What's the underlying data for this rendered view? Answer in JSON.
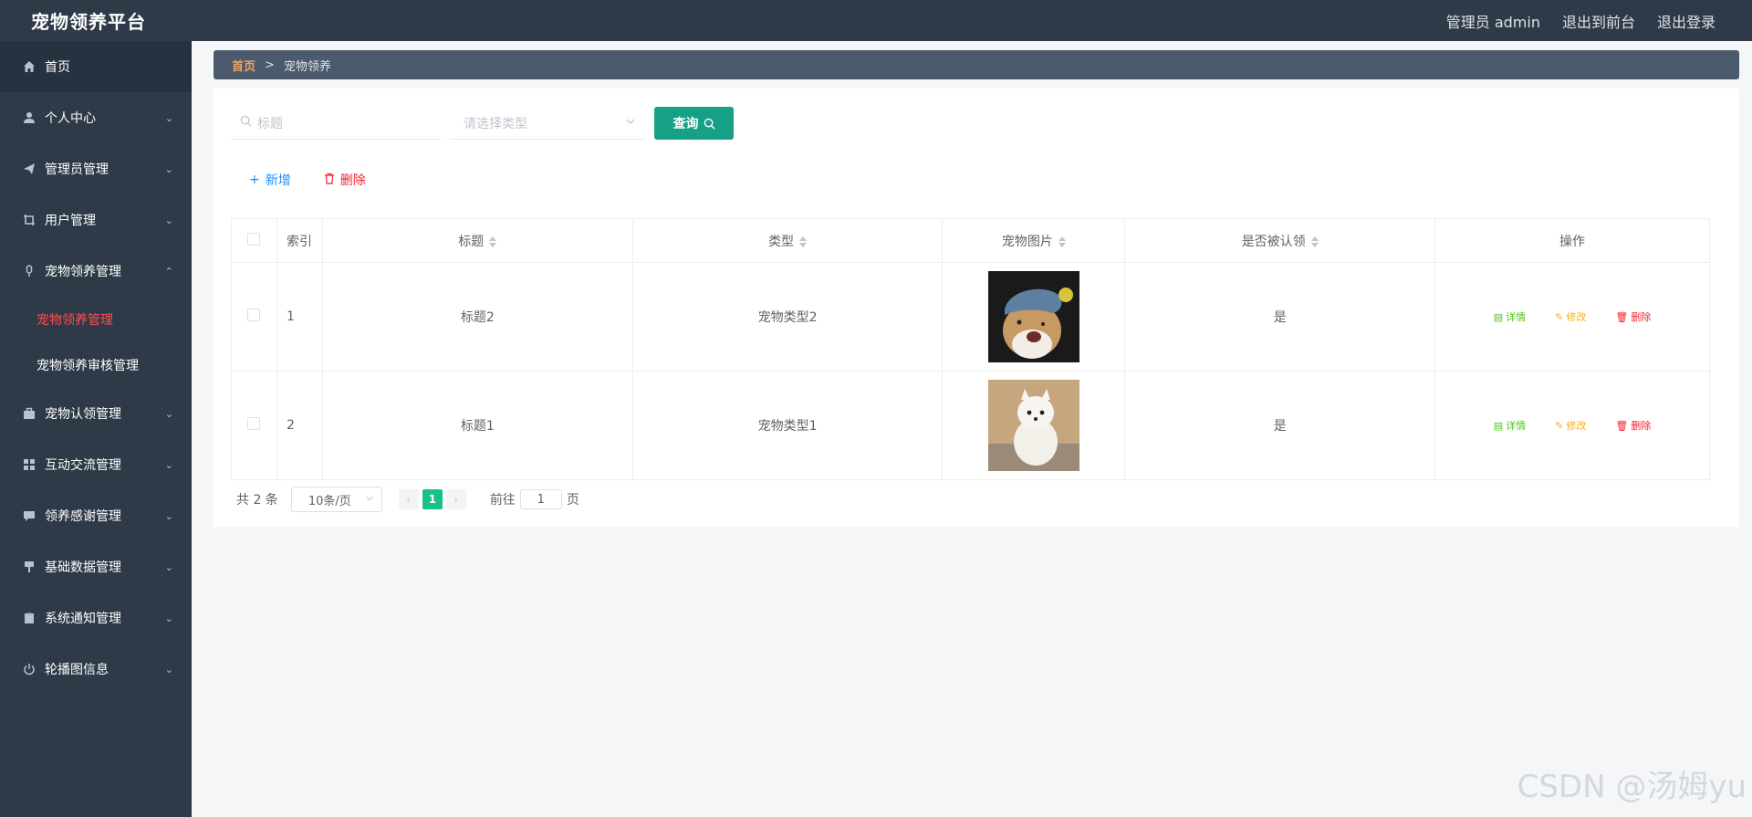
{
  "header": {
    "brand": "宠物领养平台",
    "admin_label": "管理员 admin",
    "front_link": "退出到前台",
    "logout_link": "退出登录"
  },
  "sidebar": {
    "items": [
      {
        "label": "首页",
        "icon": "home-icon"
      },
      {
        "label": "个人中心",
        "icon": "user-icon"
      },
      {
        "label": "管理员管理",
        "icon": "send-icon"
      },
      {
        "label": "用户管理",
        "icon": "crop-icon"
      },
      {
        "label": "宠物领养管理",
        "icon": "mic-icon",
        "expanded": true,
        "children": [
          {
            "label": "宠物领养管理",
            "active": true
          },
          {
            "label": "宠物领养审核管理",
            "active": false
          }
        ]
      },
      {
        "label": "宠物认领管理",
        "icon": "briefcase-icon"
      },
      {
        "label": "互动交流管理",
        "icon": "grid-icon"
      },
      {
        "label": "领养感谢管理",
        "icon": "comment-icon"
      },
      {
        "label": "基础数据管理",
        "icon": "pin-icon"
      },
      {
        "label": "系统通知管理",
        "icon": "clipboard-icon"
      },
      {
        "label": "轮播图信息",
        "icon": "power-icon"
      }
    ]
  },
  "breadcrumb": {
    "home": "首页",
    "separator": ">",
    "current": "宠物领养"
  },
  "search": {
    "title_placeholder": "标题",
    "type_placeholder": "请选择类型",
    "query_button": "查询"
  },
  "actions": {
    "add": "新增",
    "delete": "删除"
  },
  "table": {
    "columns": [
      "索引",
      "标题",
      "类型",
      "宠物图片",
      "是否被认领",
      "操作"
    ],
    "rows": [
      {
        "index": "1",
        "title": "标题2",
        "type": "宠物类型2",
        "image": "dog-with-hat",
        "claimed": "是"
      },
      {
        "index": "2",
        "title": "标题1",
        "type": "宠物类型1",
        "image": "white-pomeranian",
        "claimed": "是"
      }
    ],
    "row_actions": {
      "detail": "详情",
      "edit": "修改",
      "delete": "删除"
    }
  },
  "pagination": {
    "total_text": "共 2 条",
    "page_size": "10条/页",
    "current_page": "1",
    "jump_prefix": "前往",
    "jump_value": "1",
    "jump_suffix": "页"
  },
  "watermark": "CSDN @汤姆yu",
  "colors": {
    "header_bg": "#2e3a47",
    "accent_teal": "#16a085",
    "active_red": "#ff4d4f",
    "crumb_home": "#f0a55a"
  }
}
